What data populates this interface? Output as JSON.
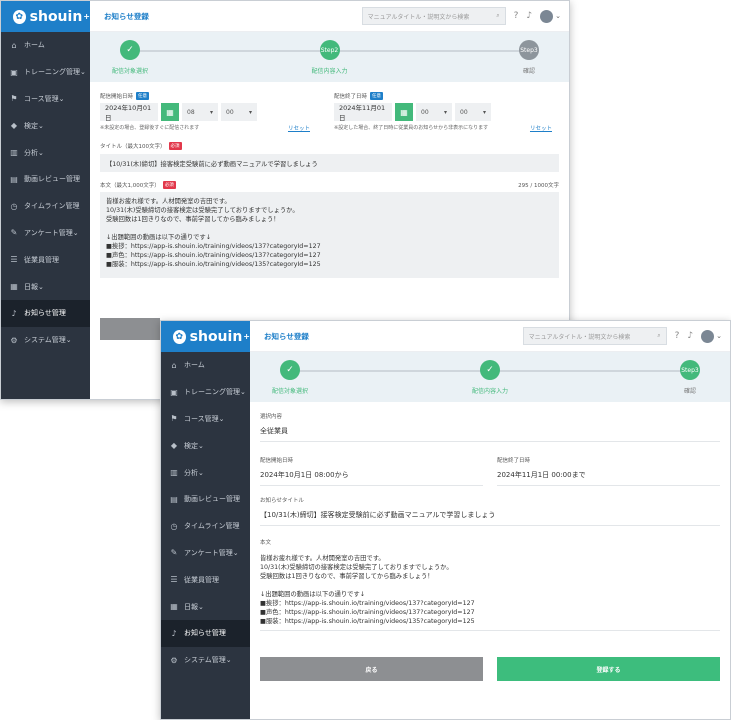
{
  "app": {
    "logo": "shouin",
    "logo_sup": "+"
  },
  "header": {
    "title": "お知らせ登録",
    "search_placeholder": "マニュアルタイトル・説明文から検索"
  },
  "sidebar": {
    "items": [
      {
        "label": "ホーム",
        "icon": "home-icon",
        "glyph": "⌂"
      },
      {
        "label": "トレーニング管理⌄",
        "icon": "video-icon",
        "glyph": "▣"
      },
      {
        "label": "コース管理⌄",
        "icon": "flag-icon",
        "glyph": "⚑"
      },
      {
        "label": "検定⌄",
        "icon": "graduation-cap-icon",
        "glyph": "◆"
      },
      {
        "label": "分析⌄",
        "icon": "bar-chart-icon",
        "glyph": "▥"
      },
      {
        "label": "動画レビュー管理",
        "icon": "film-icon",
        "glyph": "▤"
      },
      {
        "label": "タイムライン管理",
        "icon": "clock-icon",
        "glyph": "◷"
      },
      {
        "label": "アンケート管理⌄",
        "icon": "survey-icon",
        "glyph": "✎"
      },
      {
        "label": "従業員管理",
        "icon": "list-icon",
        "glyph": "☰"
      },
      {
        "label": "日報⌄",
        "icon": "report-icon",
        "glyph": "▦"
      },
      {
        "label": "お知らせ管理",
        "icon": "bell-icon",
        "glyph": "♪"
      },
      {
        "label": "システム管理⌄",
        "icon": "gear-icon",
        "glyph": "⚙"
      }
    ],
    "active_index": 10
  },
  "steps": [
    {
      "label": "配信対象選択",
      "circle": "✓"
    },
    {
      "label": "配信内容入力",
      "circle": "Step2"
    },
    {
      "label": "確認",
      "circle": "Step3"
    }
  ],
  "steps_b": [
    {
      "label": "配信対象選択",
      "circle": "✓"
    },
    {
      "label": "配信内容入力",
      "circle": "✓"
    },
    {
      "label": "確認",
      "circle": "Step3"
    }
  ],
  "form": {
    "start_label": "配信開始日時",
    "start_badge": "任意",
    "start_date": "2024年10月01日",
    "start_hour": "08",
    "start_min": "00",
    "start_note": "※未設定の場合、登録後すぐに配信されます",
    "end_label": "配信終了日時",
    "end_badge": "任意",
    "end_date": "2024年11月01日",
    "end_hour": "00",
    "end_min": "00",
    "end_note": "※設定した場合、終了日時に従業員のお知らせから非表示になります",
    "reset": "リセット",
    "title_label": "タイトル（最大100文字）",
    "title_badge": "必須",
    "title_value": "【10/31(木)締切】接客検定受験前に必ず動画マニュアルで学習しましょう",
    "body_label": "本文（最大1,000文字）",
    "body_badge": "必須",
    "body_count": "295 / 1000文字"
  },
  "body_lines": [
    "皆様お疲れ様です。人材開発室の吉田です。",
    "10/31(木)受験締切の接客検定は受験完了しておりますでしょうか。",
    "受験回数は1回きりなので、事前学習してから臨みましょう！",
    "",
    "↓出題範囲の動画は以下の通りです↓",
    "■挨拶：https://app-is.shouin.io/training/videos/137?categoryId=127",
    "■声色：https://app-is.shouin.io/training/videos/137?categoryId=127",
    "■服装：https://app-is.shouin.io/training/videos/135?categoryId=125"
  ],
  "confirm": {
    "target_label": "選択内容",
    "target_value": "全従業員",
    "start_label": "配信開始日時",
    "start_value": "2024年10月1日 08:00から",
    "end_label": "配信終了日時",
    "end_value": "2024年11月1日 00:00まで",
    "title_label": "お知らせタイトル",
    "title_value": "【10/31(木)締切】接客検定受験前に必ず動画マニュアルで学習しましょう",
    "body_label": "本文",
    "back_label": "戻る",
    "submit_label": "登録する"
  }
}
